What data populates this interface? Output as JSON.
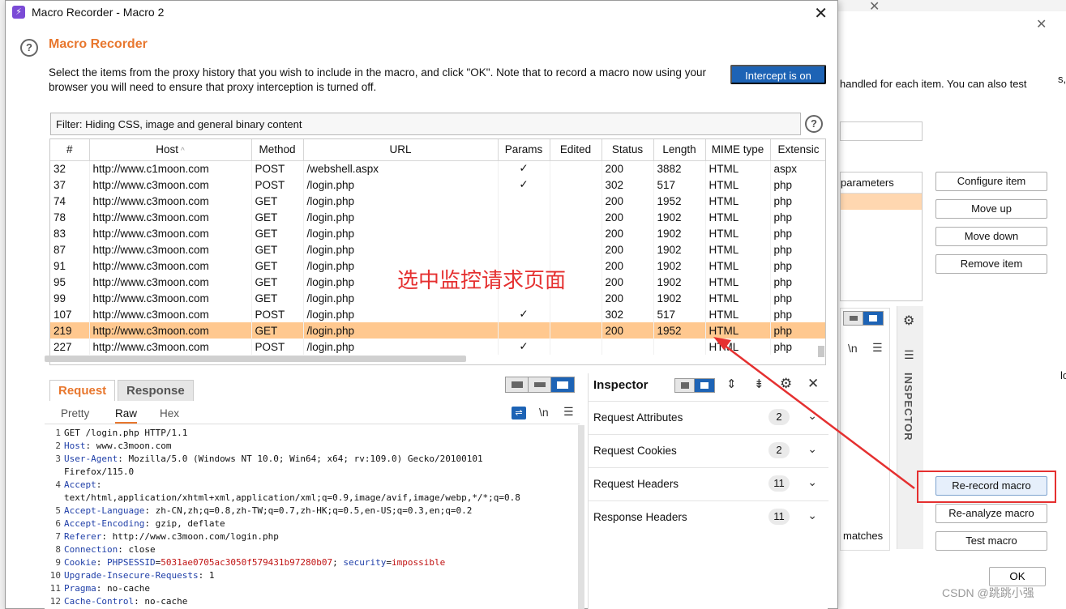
{
  "window": {
    "title": "Macro Recorder - Macro 2",
    "heading": "Macro Recorder",
    "description": "Select the items from the proxy history that you wish to include in the macro, and click \"OK\". Note that to record a macro now using your browser you will need to ensure that proxy interception is turned off.",
    "intercept_label": "Intercept is on",
    "filter_text": "Filter: Hiding CSS, image and general binary content"
  },
  "table": {
    "columns": [
      "#",
      "Host",
      "Method",
      "URL",
      "Params",
      "Edited",
      "Status",
      "Length",
      "MIME type",
      "Extensic"
    ],
    "host_sort_indicator": "^",
    "rows": [
      {
        "id": "32",
        "host": "http://www.c1moon.com",
        "method": "POST",
        "url": "/webshell.aspx",
        "params": "✓",
        "edited": "",
        "status": "200",
        "length": "3882",
        "mime": "HTML",
        "ext": "aspx"
      },
      {
        "id": "37",
        "host": "http://www.c3moon.com",
        "method": "POST",
        "url": "/login.php",
        "params": "✓",
        "edited": "",
        "status": "302",
        "length": "517",
        "mime": "HTML",
        "ext": "php"
      },
      {
        "id": "74",
        "host": "http://www.c3moon.com",
        "method": "GET",
        "url": "/login.php",
        "params": "",
        "edited": "",
        "status": "200",
        "length": "1952",
        "mime": "HTML",
        "ext": "php"
      },
      {
        "id": "78",
        "host": "http://www.c3moon.com",
        "method": "GET",
        "url": "/login.php",
        "params": "",
        "edited": "",
        "status": "200",
        "length": "1902",
        "mime": "HTML",
        "ext": "php"
      },
      {
        "id": "83",
        "host": "http://www.c3moon.com",
        "method": "GET",
        "url": "/login.php",
        "params": "",
        "edited": "",
        "status": "200",
        "length": "1902",
        "mime": "HTML",
        "ext": "php"
      },
      {
        "id": "87",
        "host": "http://www.c3moon.com",
        "method": "GET",
        "url": "/login.php",
        "params": "",
        "edited": "",
        "status": "200",
        "length": "1902",
        "mime": "HTML",
        "ext": "php"
      },
      {
        "id": "91",
        "host": "http://www.c3moon.com",
        "method": "GET",
        "url": "/login.php",
        "params": "",
        "edited": "",
        "status": "200",
        "length": "1902",
        "mime": "HTML",
        "ext": "php"
      },
      {
        "id": "95",
        "host": "http://www.c3moon.com",
        "method": "GET",
        "url": "/login.php",
        "params": "",
        "edited": "",
        "status": "200",
        "length": "1902",
        "mime": "HTML",
        "ext": "php"
      },
      {
        "id": "99",
        "host": "http://www.c3moon.com",
        "method": "GET",
        "url": "/login.php",
        "params": "",
        "edited": "",
        "status": "200",
        "length": "1902",
        "mime": "HTML",
        "ext": "php"
      },
      {
        "id": "107",
        "host": "http://www.c3moon.com",
        "method": "POST",
        "url": "/login.php",
        "params": "✓",
        "edited": "",
        "status": "302",
        "length": "517",
        "mime": "HTML",
        "ext": "php"
      },
      {
        "id": "219",
        "host": "http://www.c3moon.com",
        "method": "GET",
        "url": "/login.php",
        "params": "",
        "edited": "",
        "status": "200",
        "length": "1952",
        "mime": "HTML",
        "ext": "php",
        "selected": true
      },
      {
        "id": "227",
        "host": "http://www.c3moon.com",
        "method": "POST",
        "url": "/login.php",
        "params": "✓",
        "edited": "",
        "status": "",
        "length": "",
        "mime": "HTML",
        "ext": "php"
      }
    ]
  },
  "annotation": "选中监控请求页面",
  "request_panel": {
    "tab_request": "Request",
    "tab_response": "Response",
    "subtab_pretty": "Pretty",
    "subtab_raw": "Raw",
    "subtab_hex": "Hex",
    "newline_toggle": "\\n",
    "lines": [
      {
        "n": "1",
        "parts": [
          {
            "t": "GET /login.php HTTP/1.1",
            "c": ""
          }
        ]
      },
      {
        "n": "2",
        "parts": [
          {
            "t": "Host",
            "c": "hk"
          },
          {
            "t": ": www.c3moon.com",
            "c": ""
          }
        ]
      },
      {
        "n": "3",
        "parts": [
          {
            "t": "User-Agent",
            "c": "hk"
          },
          {
            "t": ": Mozilla/5.0 (Windows NT 10.0; Win64; x64; rv:109.0) Gecko/20100101",
            "c": ""
          }
        ]
      },
      {
        "n": "",
        "parts": [
          {
            "t": "Firefox/115.0",
            "c": ""
          }
        ]
      },
      {
        "n": "4",
        "parts": [
          {
            "t": "Accept",
            "c": "hk"
          },
          {
            "t": ":",
            "c": ""
          }
        ]
      },
      {
        "n": "",
        "parts": [
          {
            "t": "text/html,application/xhtml+xml,application/xml;q=0.9,image/avif,image/webp,*/*;q=0.8",
            "c": ""
          }
        ]
      },
      {
        "n": "5",
        "parts": [
          {
            "t": "Accept-Language",
            "c": "hk"
          },
          {
            "t": ": zh-CN,zh;q=0.8,zh-TW;q=0.7,zh-HK;q=0.5,en-US;q=0.3,en;q=0.2",
            "c": ""
          }
        ]
      },
      {
        "n": "6",
        "parts": [
          {
            "t": "Accept-Encoding",
            "c": "hk"
          },
          {
            "t": ": gzip, deflate",
            "c": ""
          }
        ]
      },
      {
        "n": "7",
        "parts": [
          {
            "t": "Referer",
            "c": "hk"
          },
          {
            "t": ": http://www.c3moon.com/login.php",
            "c": ""
          }
        ]
      },
      {
        "n": "8",
        "parts": [
          {
            "t": "Connection",
            "c": "hk"
          },
          {
            "t": ": close",
            "c": ""
          }
        ]
      },
      {
        "n": "9",
        "parts": [
          {
            "t": "Cookie",
            "c": "hk"
          },
          {
            "t": ": ",
            "c": ""
          },
          {
            "t": "PHPSESSID",
            "c": "ck"
          },
          {
            "t": "=",
            "c": ""
          },
          {
            "t": "5031ae0705ac3050f579431b97280b07",
            "c": "cv"
          },
          {
            "t": "; ",
            "c": ""
          },
          {
            "t": "security",
            "c": "ck"
          },
          {
            "t": "=",
            "c": ""
          },
          {
            "t": "impossible",
            "c": "cv"
          }
        ]
      },
      {
        "n": "10",
        "parts": [
          {
            "t": "Upgrade-Insecure-Requests",
            "c": "hk"
          },
          {
            "t": ": 1",
            "c": ""
          }
        ]
      },
      {
        "n": "11",
        "parts": [
          {
            "t": "Pragma",
            "c": "hk"
          },
          {
            "t": ": no-cache",
            "c": ""
          }
        ]
      },
      {
        "n": "12",
        "parts": [
          {
            "t": "Cache-Control",
            "c": "hk"
          },
          {
            "t": ": no-cache",
            "c": ""
          }
        ]
      }
    ]
  },
  "inspector": {
    "title": "Inspector",
    "rows": [
      {
        "label": "Request Attributes",
        "count": "2"
      },
      {
        "label": "Request Cookies",
        "count": "2"
      },
      {
        "label": "Request Headers",
        "count": "11"
      },
      {
        "label": "Response Headers",
        "count": "11"
      }
    ]
  },
  "background_window": {
    "text_handled": "handled for each item. You can also test",
    "text_s": "s,",
    "text_parameters": "parameters",
    "text_matches": "matches",
    "text_lo": "lo",
    "side_label": "INSPECTOR",
    "newline_toggle": "\\n",
    "buttons": {
      "configure": "Configure item",
      "move_up": "Move up",
      "move_down": "Move down",
      "remove": "Remove item",
      "rerecord": "Re-record macro",
      "reanalyze": "Re-analyze macro",
      "test": "Test macro",
      "ok": "OK"
    }
  },
  "watermark": "CSDN @跳跳小强",
  "colors": {
    "accent_orange": "#e8772e",
    "selected_row": "#ffc88f",
    "intercept_blue": "#1d63b5",
    "annotation_red": "#e53030"
  }
}
